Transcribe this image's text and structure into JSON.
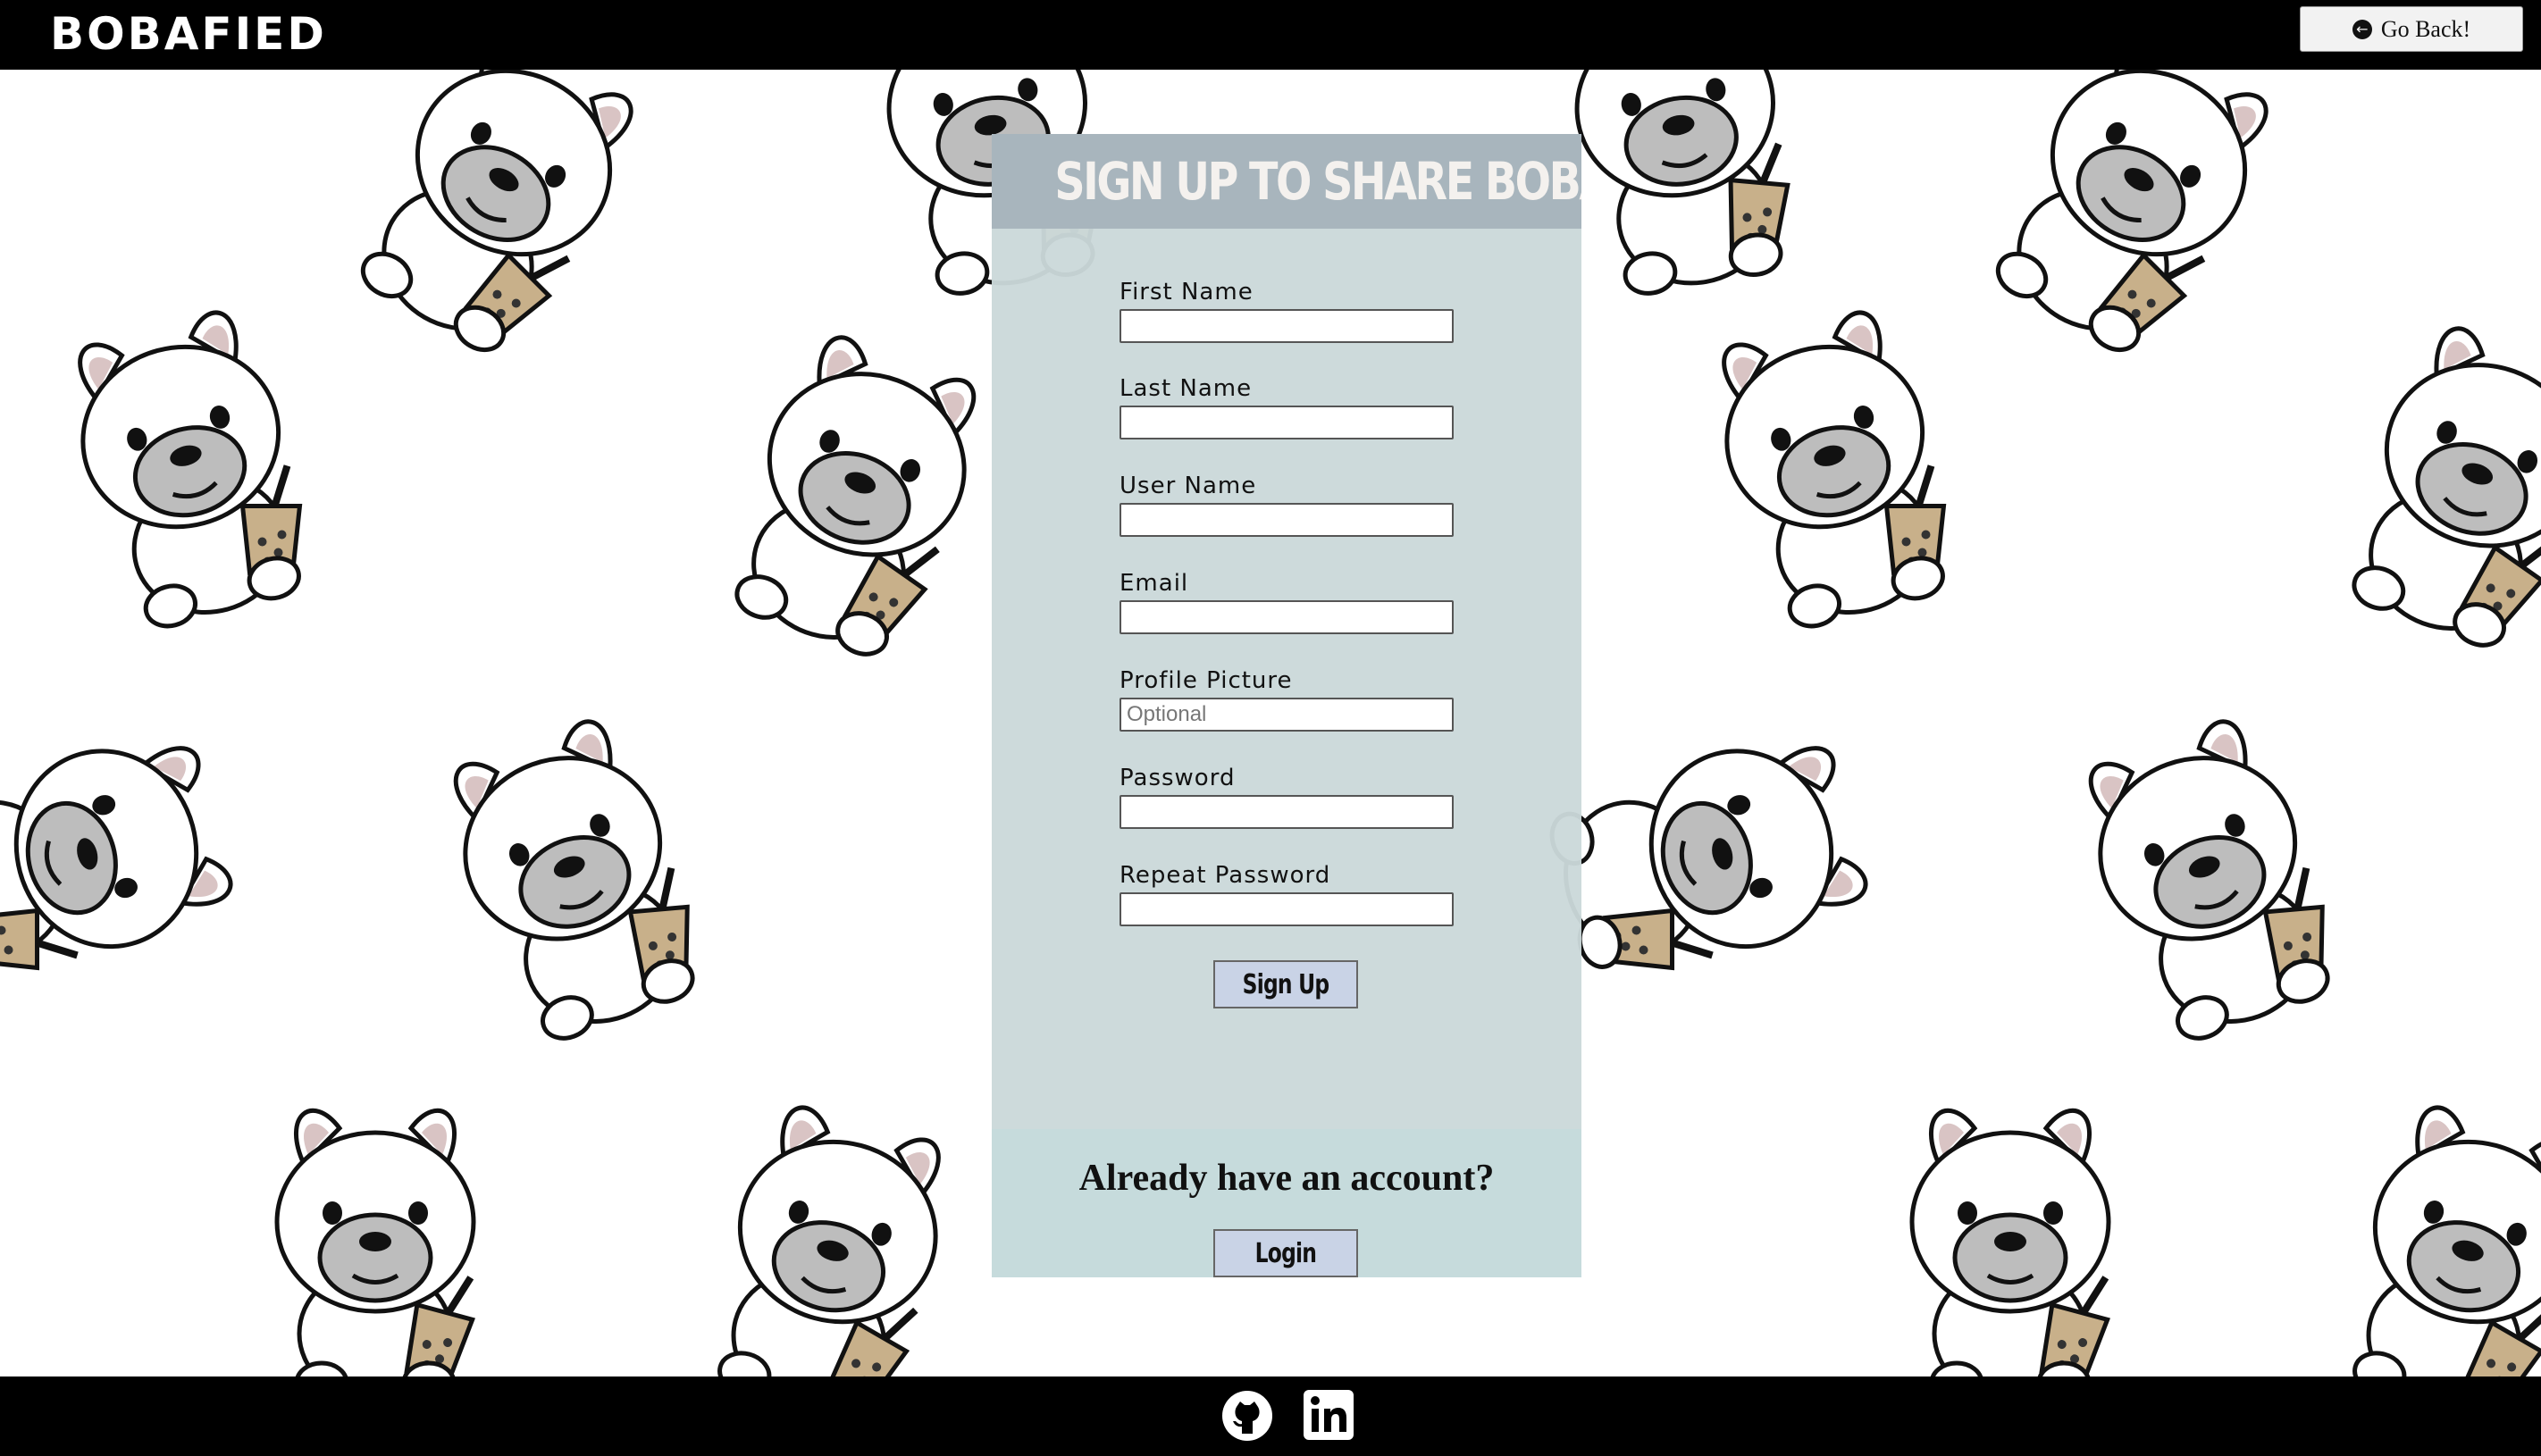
{
  "header": {
    "logo": "BOBAFIED",
    "go_back_label": "Go Back!",
    "go_back_icon": "arrow-circle-left-icon"
  },
  "form": {
    "title": "SIGN UP TO SHARE BOBA!",
    "fields": [
      {
        "label": "First Name",
        "placeholder": "",
        "value": ""
      },
      {
        "label": "Last Name",
        "placeholder": "",
        "value": ""
      },
      {
        "label": "User Name",
        "placeholder": "",
        "value": ""
      },
      {
        "label": "Email",
        "placeholder": "",
        "value": ""
      },
      {
        "label": "Profile Picture",
        "placeholder": "Optional",
        "value": ""
      },
      {
        "label": "Password",
        "placeholder": "",
        "value": ""
      },
      {
        "label": "Repeat Password",
        "placeholder": "",
        "value": ""
      }
    ],
    "submit_label": "Sign Up"
  },
  "login": {
    "prompt": "Already have an account?",
    "button_label": "Login"
  },
  "footer": {
    "icons": [
      "github-icon",
      "linkedin-icon"
    ]
  },
  "colors": {
    "bar": "#000000",
    "card": "#cbd9da",
    "title_bg": "#a8b5bd",
    "button": "#c9d3e6",
    "login_panel": "#c6dbdc"
  }
}
